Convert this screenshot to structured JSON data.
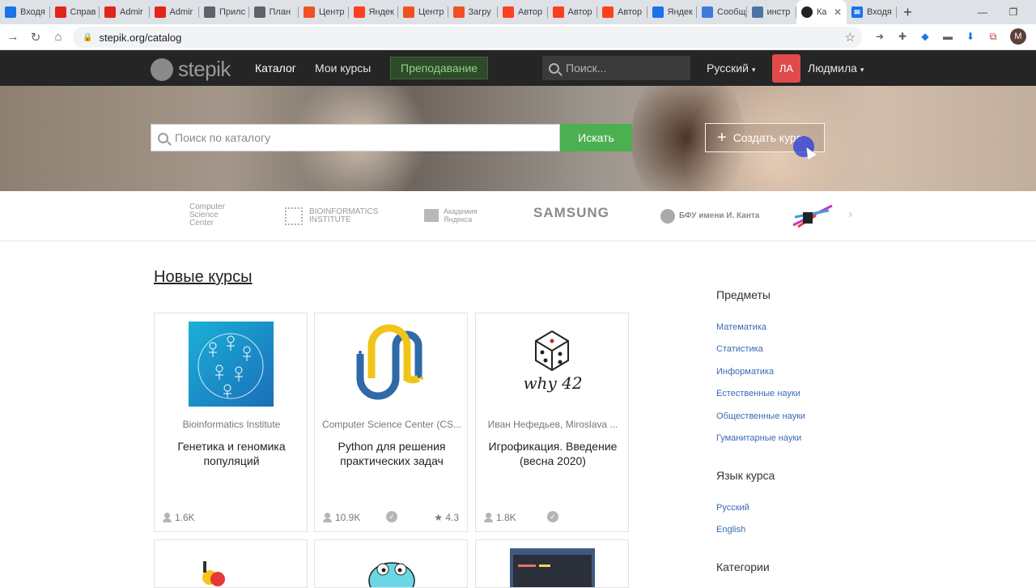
{
  "browser": {
    "tabs": [
      {
        "label": "Входя",
        "icon": "mail-icon",
        "color": "#1a73e8"
      },
      {
        "label": "Справ",
        "icon": "adobe-icon",
        "color": "#e1251b"
      },
      {
        "label": "Admir",
        "icon": "adobe-icon",
        "color": "#e1251b"
      },
      {
        "label": "Admir",
        "icon": "adobe-icon",
        "color": "#e1251b"
      },
      {
        "label": "Прилс",
        "icon": "globe-icon",
        "color": "#5f6368"
      },
      {
        "label": "План",
        "icon": "globe-icon",
        "color": "#5f6368"
      },
      {
        "label": "Центр",
        "icon": "microsoft-icon",
        "color": "#f25022"
      },
      {
        "label": "Яндек",
        "icon": "yandex-icon",
        "color": "#fc3f1d"
      },
      {
        "label": "Центр",
        "icon": "microsoft-icon",
        "color": "#f25022"
      },
      {
        "label": "Загру",
        "icon": "microsoft-icon",
        "color": "#f25022"
      },
      {
        "label": "Автор",
        "icon": "yandex-icon",
        "color": "#fc3f1d"
      },
      {
        "label": "Автор",
        "icon": "yandex-icon",
        "color": "#fc3f1d"
      },
      {
        "label": "Автор",
        "icon": "yandex-icon",
        "color": "#fc3f1d"
      },
      {
        "label": "Яндек",
        "icon": "edge-icon",
        "color": "#1a73e8"
      },
      {
        "label": "Сообщ",
        "icon": "chat-icon",
        "color": "#3d7bd8"
      },
      {
        "label": "инстр",
        "icon": "vk-icon",
        "color": "#4c75a3"
      }
    ],
    "active_tab": {
      "label": "Ка",
      "icon": "stepik-icon"
    },
    "last_tab": {
      "label": "Входя",
      "icon": "mail-icon"
    },
    "url": "stepik.org/catalog",
    "profile_initial": "M"
  },
  "header": {
    "logo_text": "stepik",
    "nav": [
      "Каталог",
      "Мои курсы"
    ],
    "teach_label": "Преподавание",
    "search_placeholder": "Поиск...",
    "language": "Русский",
    "avatar_initials": "ЛА",
    "username": "Людмила"
  },
  "hero": {
    "search_placeholder": "Поиск по каталогу",
    "search_button": "Искать",
    "create_button": "Создать курс"
  },
  "partners": {
    "csc": "Computer Science Center",
    "bioinf": "BIOINFORMATICS INSTITUTE",
    "yandex_academy": "Академия Яндекса",
    "samsung": "SAMSUNG",
    "bfu": "БФУ имени И. Канта"
  },
  "main": {
    "section_title": "Новые курсы",
    "cards": [
      {
        "author": "Bioinformatics Institute",
        "title": "Генетика и геномика популяций",
        "learners": "1.6K",
        "cert": false,
        "rating": ""
      },
      {
        "author": "Computer Science Center (CS...",
        "title": "Python для решения практических задач",
        "learners": "10.9K",
        "cert": true,
        "rating": "4.3"
      },
      {
        "author": "Иван Нефедьев,  Miroslava ...",
        "title": "Игрофикация. Введение (весна 2020)",
        "learners": "1.8K",
        "cert": true,
        "rating": ""
      }
    ],
    "why42_text": "why 42"
  },
  "sidebar": {
    "subjects_title": "Предметы",
    "subjects": [
      "Математика",
      "Статистика",
      "Информатика",
      "Естественные науки",
      "Общественные науки",
      "Гуманитарные науки"
    ],
    "lang_title": "Язык курса",
    "langs": [
      "Русский",
      "English"
    ],
    "categories_title": "Категории"
  },
  "colors": {
    "green": "#4caf50",
    "header_bg": "#252525",
    "link": "#3a6ab4",
    "avatar": "#e04a4a"
  }
}
